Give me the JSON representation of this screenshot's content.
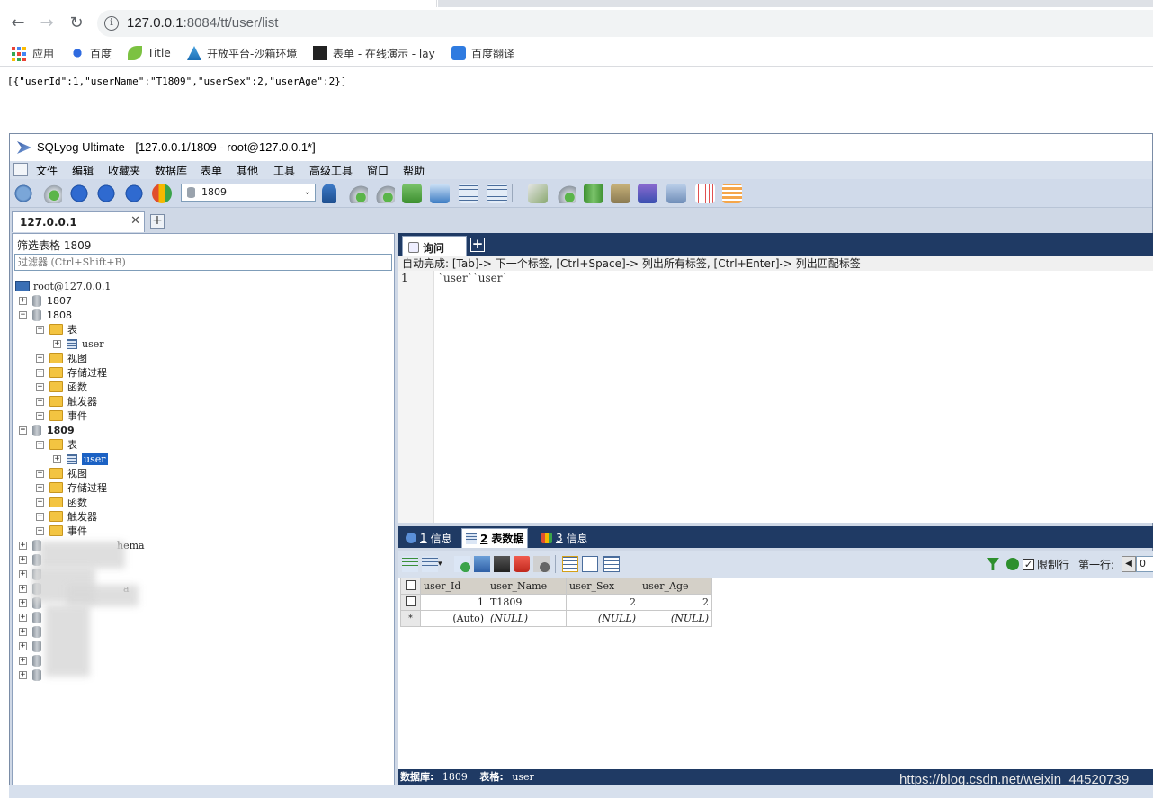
{
  "browser": {
    "url_host": "127.0.0.1",
    "url_rest": ":8084/tt/user/list",
    "bookmarks": [
      "应用",
      "百度",
      "Title",
      "开放平台-沙箱环境",
      "表单 - 在线演示 - lay",
      "百度翻译"
    ]
  },
  "page": {
    "json_text": "[{\"userId\":1,\"userName\":\"T1809\",\"userSex\":2,\"userAge\":2}]"
  },
  "sqlyog": {
    "title": "SQLyog Ultimate - [127.0.0.1/1809 - root@127.0.0.1*]",
    "menu": [
      "文件",
      "编辑",
      "收藏夹",
      "数据库",
      "表单",
      "其他",
      "工具",
      "高级工具",
      "窗口",
      "帮助"
    ],
    "db_select": "1809",
    "conn_tab": "127.0.0.1",
    "filter_label": "筛选表格 1809",
    "filter_placeholder": "过滤器 (Ctrl+Shift+B)",
    "tree": {
      "root": "root@127.0.0.1",
      "db1807": "1807",
      "db1808": "1808",
      "db1809": "1809",
      "tables": "表",
      "views": "视图",
      "procs": "存储过程",
      "funcs": "函数",
      "triggers": "触发器",
      "events": "事件",
      "user": "user",
      "frag1": "hema",
      "frag2": "a"
    },
    "query_tab": "询问",
    "hint": "自动完成: [Tab]-> 下一个标签, [Ctrl+Space]-> 列出所有标签, [Ctrl+Enter]-> 列出匹配标签",
    "line_no": "1",
    "code": "`user``user`",
    "result_tabs": [
      {
        "num": "1",
        "label": "信息"
      },
      {
        "num": "2",
        "label": "表数据"
      },
      {
        "num": "3",
        "label": "信息"
      }
    ],
    "limit_label": "限制行",
    "first_row_label": "第一行:",
    "first_row_value": "0",
    "columns": [
      "user_Id",
      "user_Name",
      "user_Sex",
      "user_Age"
    ],
    "row1": {
      "id": "1",
      "name": "T1809",
      "sex": "2",
      "age": "2"
    },
    "row2": {
      "id": "(Auto)",
      "name": "(NULL)",
      "sex": "(NULL)",
      "age": "(NULL)"
    },
    "status_db_label": "数据库:",
    "status_db": "1809",
    "status_tbl_label": "表格:",
    "status_tbl": "user",
    "watermark": "https://blog.csdn.net/weixin_44520739"
  },
  "colors": {
    "navy": "#1f3a64",
    "selection": "#1c62c4",
    "folder": "#f3c441"
  }
}
